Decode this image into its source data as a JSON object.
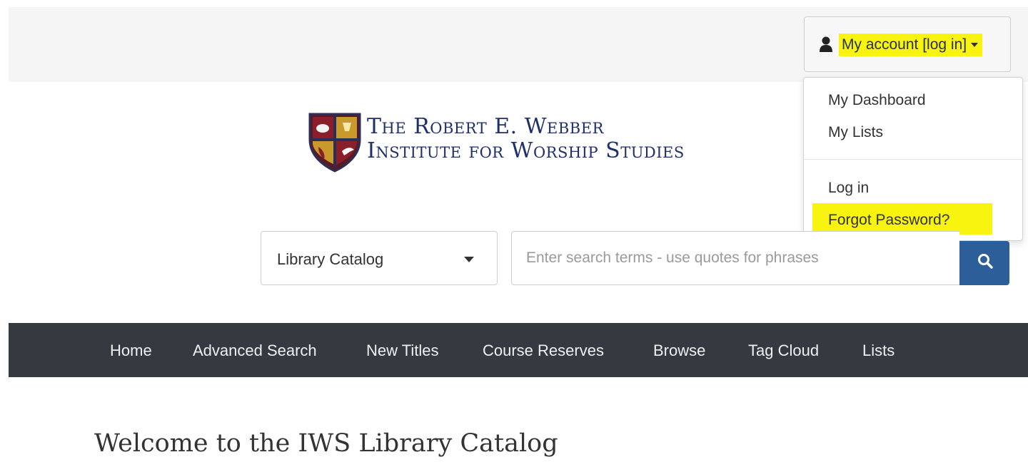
{
  "account": {
    "label": "My account [log in]",
    "menu": {
      "dashboard": "My Dashboard",
      "lists": "My Lists",
      "login": "Log in",
      "forgot": "Forgot Password?"
    }
  },
  "logo": {
    "line1": "The Robert E. Webber",
    "line2": "Institute for Worship Studies"
  },
  "search": {
    "scope": "Library Catalog",
    "placeholder": "Enter search terms - use quotes for phrases"
  },
  "nav": {
    "home": "Home",
    "advanced": "Advanced Search",
    "new_titles": "New Titles",
    "course_reserves": "Course Reserves",
    "browse": "Browse",
    "tag_cloud": "Tag Cloud",
    "lists": "Lists"
  },
  "welcome": "Welcome to the IWS Library Catalog",
  "colors": {
    "highlight": "#f8f40f",
    "nav_bg": "#343a40",
    "search_button": "#2c5e9a",
    "logo_text": "#1f2f6a"
  }
}
